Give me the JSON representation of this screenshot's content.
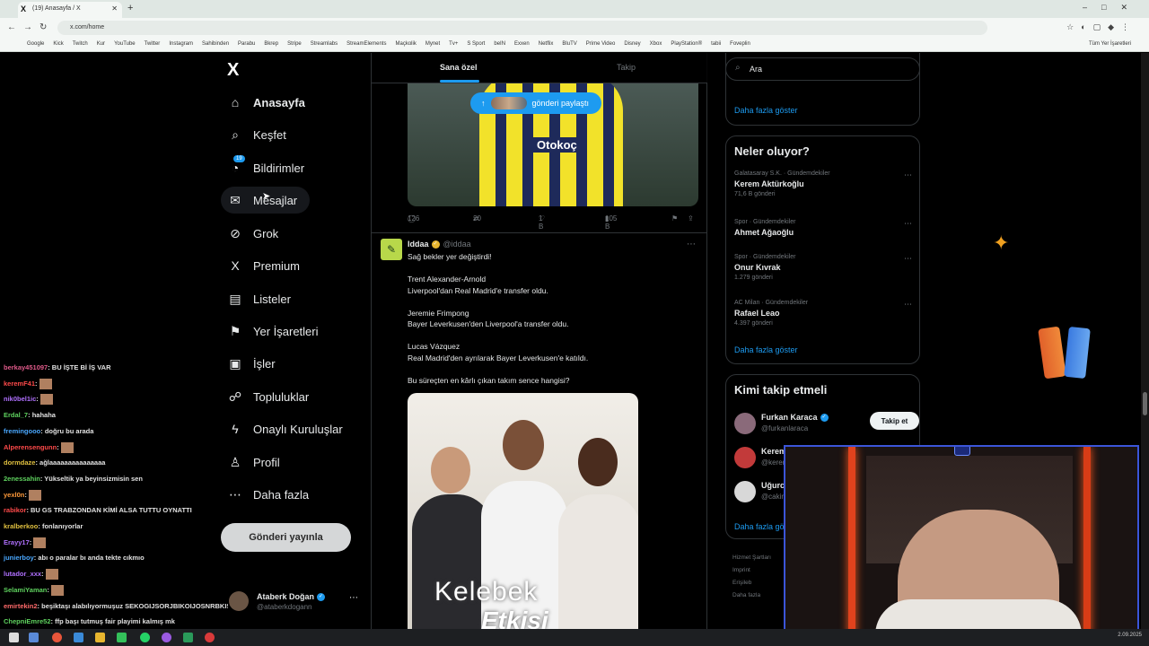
{
  "browser": {
    "tab_title": "(19) Anasayfa / X",
    "tab_icon": "X",
    "tab_close": "✕",
    "new_tab": "+",
    "url": "x.com/home",
    "bookmarks": [
      "Google",
      "Kick",
      "Twitch",
      "Kur",
      "YouTube",
      "Twitter",
      "Instagram",
      "Sahibinden",
      "Parabu",
      "Bkrep",
      "Stripe",
      "Streamlabs",
      "StreamElements",
      "Maçkolik",
      "Mynet",
      "Tv+",
      "S Sport",
      "beIN",
      "Exxen",
      "Netflix",
      "BluTV",
      "Prime Video",
      "Disney",
      "Xbox",
      "PlayStation®",
      "tabii",
      "Foveplin"
    ],
    "bookmarks_right": "Tüm Yer İşaretleri"
  },
  "sidebar": {
    "logo": "X",
    "items": [
      {
        "label": "Anasayfa",
        "icon": "home-icon",
        "glyph": "⌂"
      },
      {
        "label": "Keşfet",
        "icon": "search-icon",
        "glyph": "⌕"
      },
      {
        "label": "Bildirimler",
        "icon": "bell-icon",
        "glyph": "◔",
        "badge": "19"
      },
      {
        "label": "Mesajlar",
        "icon": "mail-icon",
        "glyph": "✉"
      },
      {
        "label": "Grok",
        "icon": "grok-icon",
        "glyph": "⊘"
      },
      {
        "label": "Premium",
        "icon": "x-premium-icon",
        "glyph": "X"
      },
      {
        "label": "Listeler",
        "icon": "list-icon",
        "glyph": "▤"
      },
      {
        "label": "Yer İşaretleri",
        "icon": "bookmark-icon",
        "glyph": "⚑"
      },
      {
        "label": "İşler",
        "icon": "briefcase-icon",
        "glyph": "▣"
      },
      {
        "label": "Topluluklar",
        "icon": "communities-icon",
        "glyph": "☍"
      },
      {
        "label": "Onaylı Kuruluşlar",
        "icon": "lightning-icon",
        "glyph": "ϟ"
      },
      {
        "label": "Profil",
        "icon": "profile-icon",
        "glyph": "♙"
      },
      {
        "label": "Daha fazla",
        "icon": "more-circle-icon",
        "glyph": "⋯"
      }
    ],
    "post_button": "Gönderi yayınla",
    "profile": {
      "name": "Ataberk Doğan",
      "handle": "@ataberkdogann"
    }
  },
  "chat": [
    {
      "user": "berkay451097",
      "color": "#e05a8a",
      "msg": ": BU İŞTE Bİ İŞ VAR",
      "emote": false
    },
    {
      "user": "keremF41",
      "color": "#ff4a4a",
      "msg": ":",
      "emote": true
    },
    {
      "user": "nik0bel1ic",
      "color": "#b070ff",
      "msg": ":",
      "emote": true
    },
    {
      "user": "Erdal_7",
      "color": "#5fd35f",
      "msg": ": hahaha",
      "emote": false
    },
    {
      "user": "fremingooo",
      "color": "#4aa8ff",
      "msg": ": doğru bu arada",
      "emote": false
    },
    {
      "user": "Alperensengunn",
      "color": "#ff4a4a",
      "msg": ":",
      "emote": true
    },
    {
      "user": "dormdaze",
      "color": "#e0c040",
      "msg": ": ağlaaaaaaaaaaaaaaa",
      "emote": false
    },
    {
      "user": "2enessahin",
      "color": "#5fd35f",
      "msg": ": Yükseltik ya beyinsizmisin sen",
      "emote": false
    },
    {
      "user": "yexl0n",
      "color": "#ff9a3a",
      "msg": ":",
      "emote": true
    },
    {
      "user": "rabikor",
      "color": "#ff4a4a",
      "msg": ": BU GS TRABZONDAN KİMİ ALSA TUTTU OYNATTI",
      "emote": false
    },
    {
      "user": "kralberkoo",
      "color": "#e0c040",
      "msg": ": fonlanıyorlar",
      "emote": false
    },
    {
      "user": "Erayy17",
      "color": "#b070ff",
      "msg": ":",
      "emote": true
    },
    {
      "user": "junierboy",
      "color": "#4aa8ff",
      "msg": ": abı o paralar bı anda tekte cıkmıo",
      "emote": false
    },
    {
      "user": "lutador_xxx",
      "color": "#b070ff",
      "msg": ":",
      "emote": true
    },
    {
      "user": "SelamiYaman",
      "color": "#5fd35f",
      "msg": ":",
      "emote": true
    },
    {
      "user": "emirtekin2",
      "color": "#ff6a6a",
      "msg": ": beşiktaşı alabılıyormuşuz SEKOGIJSORJBIKOIJOSNRBKISNOBJ",
      "emote": false
    },
    {
      "user": "ChepniEmre52",
      "color": "#5fd35f",
      "msg": ": ffp başı tutmuş fair playimi kalmış mk",
      "emote": false
    }
  ],
  "timeline": {
    "tabs": [
      "Sana özel",
      "Takip"
    ],
    "share_pill": "gönderi paylaştı",
    "jersey_sponsor": "Otokoç",
    "tweet1_actions": {
      "replies": "126",
      "reposts": "20",
      "likes": "1 B",
      "views": "105 B"
    },
    "tweet2": {
      "avatar": "✎",
      "name": "Iddaa",
      "handle": "@iddaa",
      "lines": [
        "Sağ bekler yer değiştirdi!",
        "Trent Alexander-Arnold",
        "Liverpool'dan Real Madrid'e transfer oldu.",
        "Jeremie Frimpong",
        "Bayer Leverkusen'den Liverpool'a transfer oldu.",
        "Lucas Vázquez",
        "Real Madrid'den ayrılarak Bayer Leverkusen'e katıldı.",
        "Bu süreçten en kârlı çıkan takım sence hangisi?"
      ],
      "image_text_1": "Kelebek",
      "image_text_2": "Etkisi"
    }
  },
  "right": {
    "search_placeholder": "Ara",
    "show_more": "Daha fazla göster",
    "trends_title": "Neler oluyor?",
    "trends": [
      {
        "cat": "Galatasaray S.K. · Gündemdekiler",
        "name": "Kerem Aktürkoğlu",
        "count": "71,6 B gönderi"
      },
      {
        "cat": "Spor · Gündemdekiler",
        "name": "Ahmet Ağaoğlu",
        "count": ""
      },
      {
        "cat": "Spor · Gündemdekiler",
        "name": "Onur Kıvrak",
        "count": "1.279 gönderi"
      },
      {
        "cat": "AC Milan · Gündemdekiler",
        "name": "Rafael Leao",
        "count": "4.397 gönderi"
      }
    ],
    "follow_title": "Kimi takip etmeli",
    "follow": [
      {
        "name": "Furkan Karaca",
        "handle": "@furkanlaraca",
        "button": "Takip et"
      },
      {
        "name": "Kerem",
        "handle": "@kerem"
      },
      {
        "name": "Uğurcan",
        "handle": "@cakir"
      }
    ],
    "follow_show_more": "Daha fazla gö",
    "footer": [
      "Hizmet Şartları",
      "Imprint",
      "Erişileb",
      "Daha fazla"
    ]
  },
  "taskbar": {
    "tray": "2.09.2025"
  }
}
